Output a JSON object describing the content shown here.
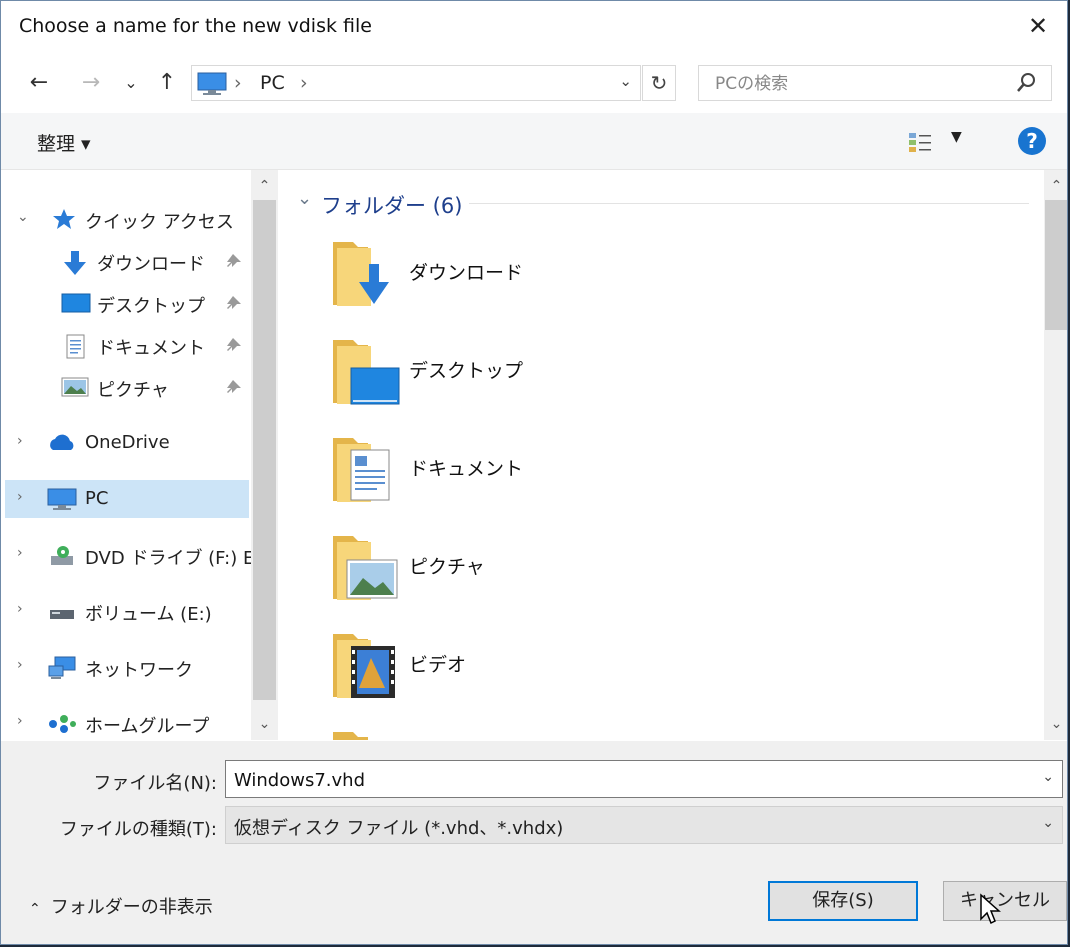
{
  "window": {
    "title": "Choose a name for the new vdisk file",
    "close_icon": "✕"
  },
  "nav": {
    "back": "←",
    "forward": "→",
    "recent": "⌄",
    "up": "↑",
    "breadcrumb": [
      "PC"
    ],
    "separator": "›",
    "refresh": "↻",
    "search_placeholder": "PCの検索"
  },
  "toolbar": {
    "organize_label": "整理 ▾",
    "help": "?"
  },
  "navpane": {
    "items": [
      {
        "label": "クイック アクセス",
        "expand": "⌄",
        "icon": "star-icon"
      },
      {
        "label": "ダウンロード",
        "icon": "download-icon",
        "pinned": true
      },
      {
        "label": "デスクトップ",
        "icon": "desktop-icon",
        "pinned": true
      },
      {
        "label": "ドキュメント",
        "icon": "document-icon",
        "pinned": true
      },
      {
        "label": "ピクチャ",
        "icon": "picture-icon",
        "pinned": true
      },
      {
        "label": "OneDrive",
        "expand": "›",
        "icon": "cloud-icon"
      },
      {
        "label": "PC",
        "expand": "›",
        "icon": "computer-icon",
        "selected": true
      },
      {
        "label": "DVD ドライブ (F:) ES",
        "expand": "›",
        "icon": "dvd-icon"
      },
      {
        "label": "ボリューム (E:)",
        "expand": "›",
        "icon": "drive-icon"
      },
      {
        "label": "ネットワーク",
        "expand": "›",
        "icon": "network-icon"
      },
      {
        "label": "ホームグループ",
        "expand": "›",
        "icon": "homegroup-icon"
      }
    ]
  },
  "content": {
    "group_header": "フォルダー (6)",
    "folders": [
      {
        "label": "ダウンロード",
        "overlay": "download"
      },
      {
        "label": "デスクトップ",
        "overlay": "desktop"
      },
      {
        "label": "ドキュメント",
        "overlay": "document"
      },
      {
        "label": "ピクチャ",
        "overlay": "picture"
      },
      {
        "label": "ビデオ",
        "overlay": "video"
      }
    ]
  },
  "bottom": {
    "filename_label": "ファイル名(N):",
    "filename_value": "Windows7.vhd",
    "filetype_label": "ファイルの種類(T):",
    "filetype_value": "仮想ディスク ファイル (*.vhd、*.vhdx)",
    "hide_folders": "フォルダーの非表示",
    "save": "保存(S)",
    "cancel": "キャンセル"
  },
  "colors": {
    "accent": "#0078d7",
    "selection": "#cce4f7",
    "header": "#1e3f8c",
    "folder": "#f3c95e"
  }
}
